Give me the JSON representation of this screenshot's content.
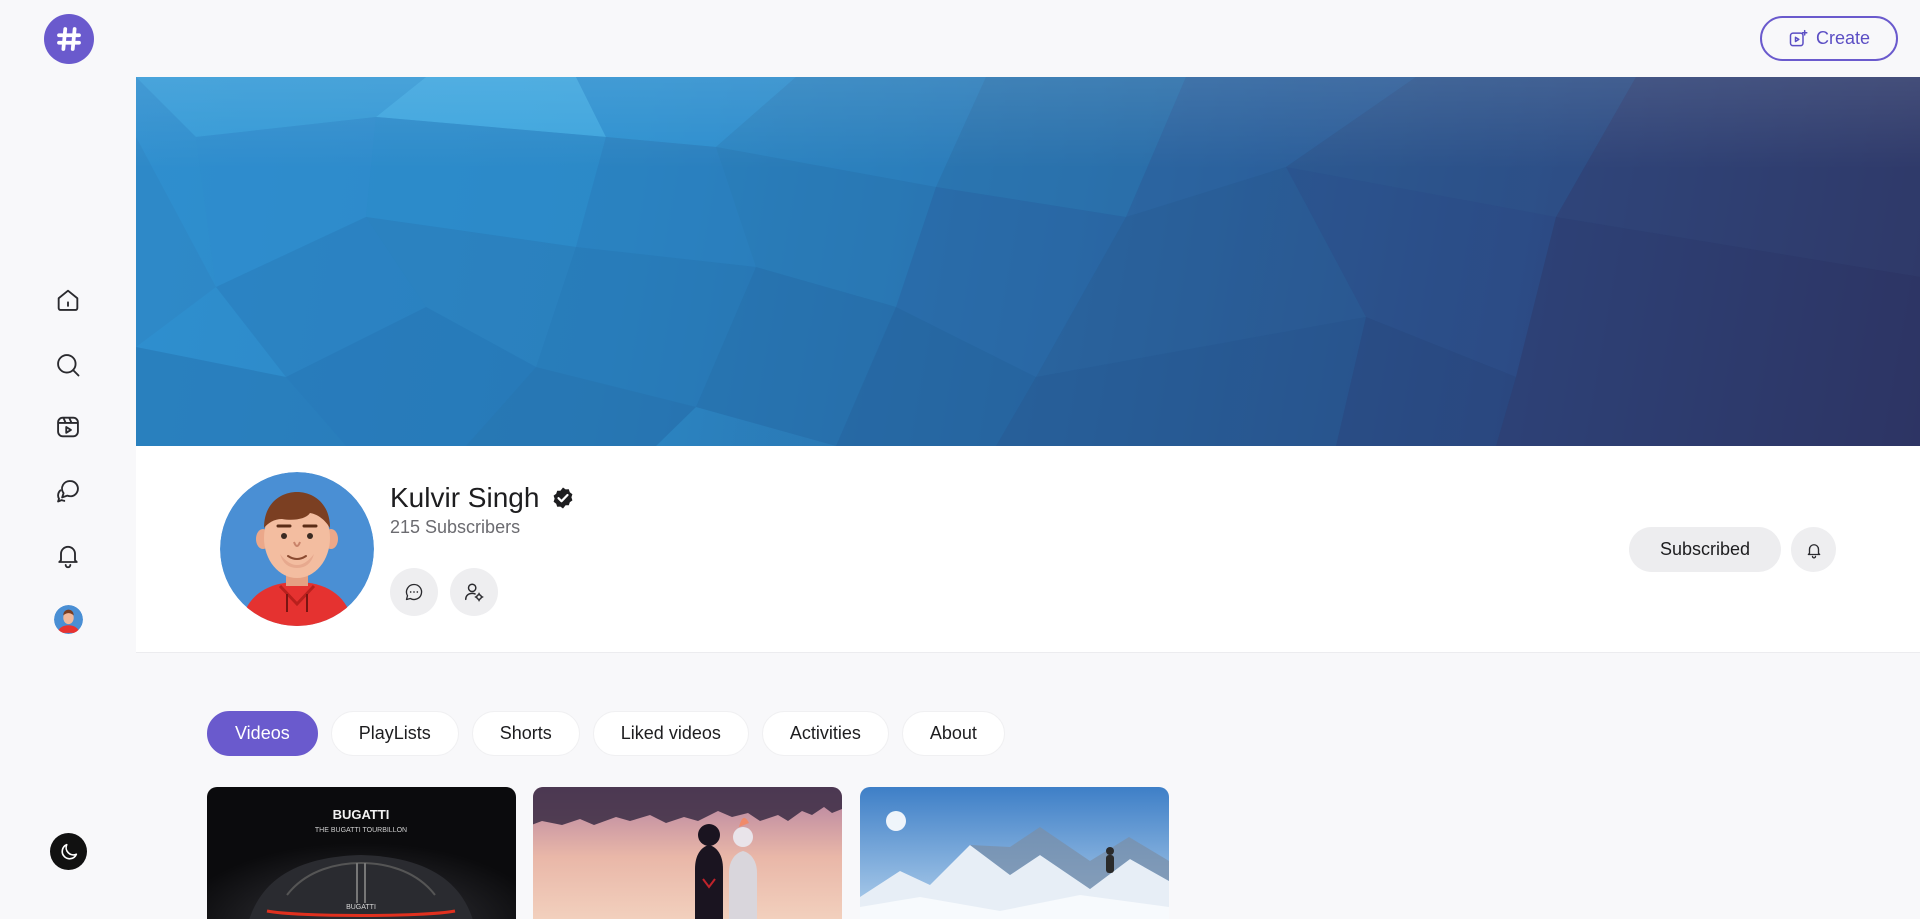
{
  "top": {
    "create_label": "Create"
  },
  "sidebar": {
    "items": [
      {
        "name": "home",
        "icon": "home-icon"
      },
      {
        "name": "search",
        "icon": "search-icon"
      },
      {
        "name": "shorts",
        "icon": "shorts-icon"
      },
      {
        "name": "chat",
        "icon": "chat-icon"
      },
      {
        "name": "notifications",
        "icon": "bell-icon"
      }
    ],
    "theme_icon": "moon-icon"
  },
  "channel": {
    "name": "Kulvir Singh",
    "subscribers": "215 Subscribers",
    "subscribe_label": "Subscribed",
    "verified_icon": "verified-check-icon"
  },
  "tabs": [
    "Videos",
    "PlayLists",
    "Shorts",
    "Liked videos",
    "Activities",
    "About"
  ],
  "active_tab": "Videos",
  "videos": [
    {
      "thumb_title": "BUGATTI",
      "thumb_subtitle": "THE BUGATTI TOURBILLON",
      "thumb_badge": "BUGATTI"
    },
    {
      "thumb_title": ""
    },
    {
      "thumb_title": ""
    }
  ],
  "colors": {
    "accent": "#6a5acd",
    "background": "#f8f8fa",
    "banner_start": "#2f8fcf",
    "banner_end": "#2f3564"
  }
}
